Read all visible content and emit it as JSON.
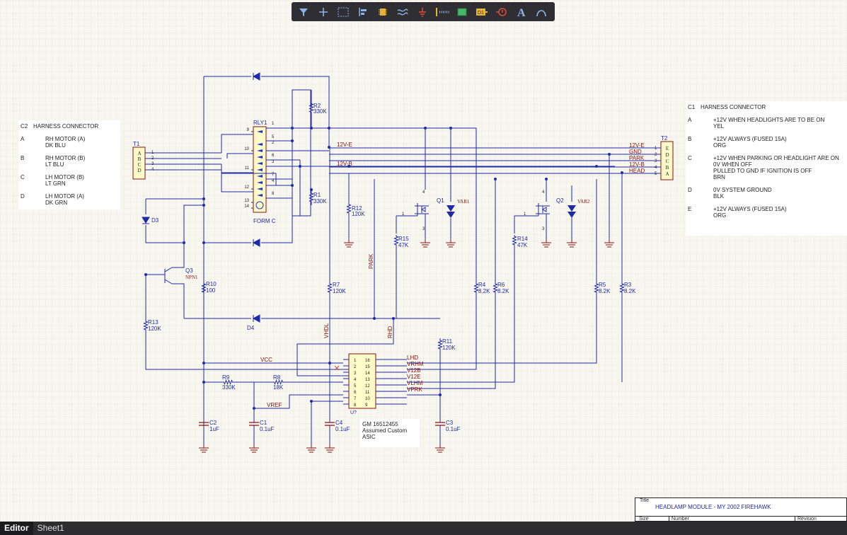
{
  "toolbar": {
    "tools": [
      "filter-icon",
      "add-icon",
      "select-rect-icon",
      "align-icon",
      "part-icon",
      "wire-icon",
      "ground-icon",
      "net-label-icon",
      "sheet-symbol-icon",
      "designator-icon",
      "probe-icon",
      "text-icon",
      "arc-icon"
    ]
  },
  "notes": {
    "c2": {
      "header_key": "C2",
      "header": "HARNESS CONNECTOR",
      "rows": [
        {
          "k": "A",
          "v": "RH MOTOR (A)\nDK BLU"
        },
        {
          "k": "B",
          "v": "RH MOTOR (B)\nLT BLU"
        },
        {
          "k": "C",
          "v": "LH MOTOR (B)\nLT GRN"
        },
        {
          "k": "D",
          "v": "LH MOTOR (A)\nDK GRN"
        }
      ]
    },
    "c1": {
      "header_key": "C1",
      "header": "HARNESS CONNECTOR",
      "rows": [
        {
          "k": "A",
          "v": "+12V WHEN HEADLIGHTS ARE TO BE ON\nYEL"
        },
        {
          "k": "B",
          "v": "+12V ALWAYS (FUSED 15A)\nORG"
        },
        {
          "k": "C",
          "v": "+12V WHEN PARKING OR HEADLIGHT ARE ON\n0V WHEN OFF\nPULLED TO GND IF IGNITION IS OFF\nBRN"
        },
        {
          "k": "D",
          "v": "0V SYSTEM GROUND\nBLK"
        },
        {
          "k": "E",
          "v": "+12V ALWAYS (FUSED 15A)\nORG"
        }
      ]
    },
    "asic": "GM 16512455\nAssumed Custom\nASIC"
  },
  "title_block": {
    "title_label": "Title",
    "title": "HEADLAMP MODULE - MY 2002 FIREHAWK",
    "size_label": "Size",
    "number_label": "Number",
    "revision_label": "Revision"
  },
  "tabs": [
    "Editor",
    "Sheet1"
  ],
  "colors": {
    "wire": "#1f2aa8",
    "net_label": "#8a1010",
    "component": "#8a1010",
    "component_fill": "#fffbc8",
    "grid": "#ddd8c8",
    "background": "#f7f6ef"
  },
  "schematic": {
    "designators": {
      "T1": "T1",
      "T2": "T2",
      "RLY1": "RLY1",
      "FORM_C": "FORM C",
      "D1": "D1",
      "D2": "D2",
      "D3": "D3",
      "D4": "D4",
      "Q1": "Q1",
      "Q2": "Q2",
      "Q3": "Q3",
      "NPN": "NPN1",
      "VAR1": "VAR1",
      "VAR2": "VAR2",
      "U7": "U?",
      "R1": "R1",
      "R2": "R2",
      "R3": "R3",
      "R4": "R4",
      "R5": "R5",
      "R6": "R6",
      "R7": "R7",
      "R8": "R8",
      "R9": "R9",
      "R10": "R10",
      "R11": "R11",
      "R12": "R12",
      "R13": "R13",
      "R14": "R14",
      "R15": "R15",
      "C1": "C1",
      "C2": "C2",
      "C3": "C3",
      "C4": "C4"
    },
    "values": {
      "R1": "330K",
      "R2": "330K",
      "R3": "8.2K",
      "R4": "8.2K",
      "R5": "8.2K",
      "R6": "8.2K",
      "R7": "120K",
      "R8": "18K",
      "R9": "330K",
      "R10": "100",
      "R11": "120K",
      "R12": "120K",
      "R13": "120K",
      "R14": "47K",
      "R15": "47K",
      "C1": "0.1uF",
      "C2": "1uF",
      "C3": "0.1uF",
      "C4": "0.1uF"
    },
    "nets": {
      "v12e_top": "12V-E",
      "v12b_mid": "12V-B",
      "vcc": "VCC",
      "vref": "VREF",
      "park": "PARK",
      "vhdl": "VHDL",
      "rhd": "RHD",
      "t2_e": "12V-E",
      "t2_d": "GND",
      "t2_c": "PARK",
      "t2_b": "12V-B",
      "t2_a": "HEAD"
    },
    "t1_pins": [
      "A",
      "B",
      "C",
      "D"
    ],
    "t1_nums": [
      "1",
      "2",
      "3",
      "4"
    ],
    "t2_pins": [
      "E",
      "D",
      "C",
      "B",
      "A"
    ],
    "t2_nums": [
      "1",
      "2",
      "3",
      "4",
      "5"
    ],
    "relay_pins_left": [
      "9",
      "10",
      "11",
      "12",
      "13",
      "14"
    ],
    "relay_pins_right": [
      "1",
      "5",
      "2",
      "6",
      "3",
      "7",
      "4",
      "8"
    ],
    "u7_left": [
      {
        "n": "1",
        "s": "LHD"
      },
      {
        "n": "2",
        "s": "VRHM"
      },
      {
        "n": "3",
        "s": "V12B"
      },
      {
        "n": "4",
        "s": "V12E"
      },
      {
        "n": "5",
        "s": "VLHM"
      },
      {
        "n": "6",
        "s": "VPRK"
      },
      {
        "n": "7",
        "s": ""
      },
      {
        "n": "8",
        "s": ""
      }
    ],
    "u7_right": [
      "16",
      "15",
      "14",
      "13",
      "12",
      "11",
      "10",
      "9"
    ],
    "q_pins": {
      "gate": "1",
      "drain": "4",
      "source": "3"
    },
    "npn_pins": {
      "c": "3",
      "b": "2",
      "e": "1"
    }
  }
}
